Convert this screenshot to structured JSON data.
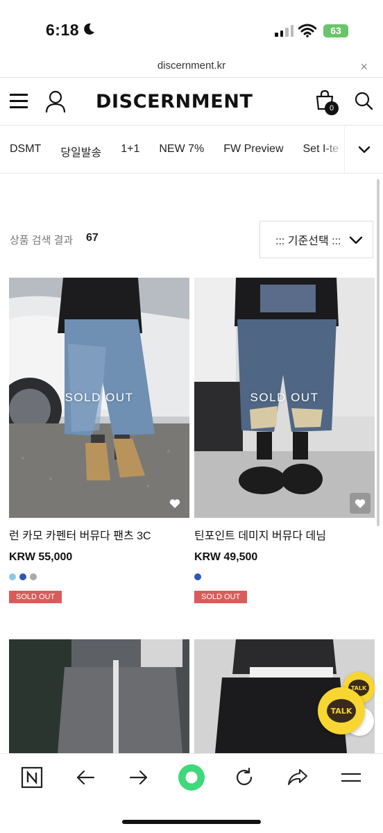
{
  "status": {
    "time": "6:18",
    "battery": "63"
  },
  "url_bar": {
    "url": "discernment.kr",
    "close": "×"
  },
  "header": {
    "logo": "DISCERNMENT",
    "cart_count": "0"
  },
  "categories": [
    "DSMT",
    "당일발송",
    "1+1",
    "NEW 7%",
    "FW Preview",
    "Set I-te"
  ],
  "search": {
    "label": "상품 검색 결과",
    "count": "67",
    "sort": "::: 기준선택 :::"
  },
  "products": [
    {
      "name": "런 카모 카펜터 버뮤다 팬츠 3C",
      "price": "KRW 55,000",
      "overlay": "SOLD OUT",
      "badge": "SOLD OUT",
      "swatches": [
        "#8fc7e6",
        "#2f57b5",
        "#a9a9a9"
      ]
    },
    {
      "name": "틴포인트 데미지 버뮤다 데님",
      "price": "KRW 49,500",
      "overlay": "SOLD OUT",
      "badge": "SOLD OUT",
      "swatches": [
        "#2f57b5"
      ]
    }
  ],
  "kakao": {
    "small": "TALK",
    "big": "TALK"
  }
}
